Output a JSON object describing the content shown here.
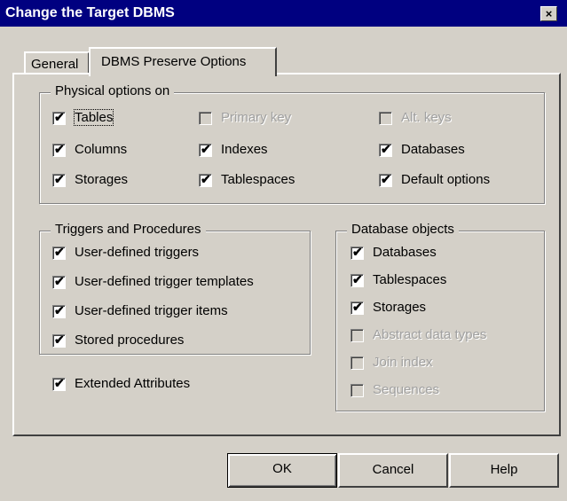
{
  "window": {
    "title": "Change the Target DBMS",
    "close_glyph": "×"
  },
  "tabs": [
    {
      "label": "General"
    },
    {
      "label": "DBMS Preserve Options"
    }
  ],
  "physical_options": {
    "title": "Physical options on",
    "items": [
      {
        "label": "Tables",
        "checked": true,
        "enabled": true
      },
      {
        "label": "Primary key",
        "checked": false,
        "enabled": false
      },
      {
        "label": "Alt. keys",
        "checked": false,
        "enabled": false
      },
      {
        "label": "Columns",
        "checked": true,
        "enabled": true
      },
      {
        "label": "Indexes",
        "checked": true,
        "enabled": true
      },
      {
        "label": "Databases",
        "checked": true,
        "enabled": true
      },
      {
        "label": "Storages",
        "checked": true,
        "enabled": true
      },
      {
        "label": "Tablespaces",
        "checked": true,
        "enabled": true
      },
      {
        "label": "Default options",
        "checked": true,
        "enabled": true
      }
    ]
  },
  "triggers": {
    "title": "Triggers and Procedures",
    "items": [
      {
        "label": "User-defined triggers",
        "checked": true,
        "enabled": true
      },
      {
        "label": "User-defined trigger templates",
        "checked": true,
        "enabled": true
      },
      {
        "label": "User-defined trigger items",
        "checked": true,
        "enabled": true
      },
      {
        "label": "Stored procedures",
        "checked": true,
        "enabled": true
      }
    ]
  },
  "extended": {
    "label": "Extended Attributes",
    "checked": true,
    "enabled": true
  },
  "db_objects": {
    "title": "Database objects",
    "items": [
      {
        "label": "Databases",
        "checked": true,
        "enabled": true
      },
      {
        "label": "Tablespaces",
        "checked": true,
        "enabled": true
      },
      {
        "label": "Storages",
        "checked": true,
        "enabled": true
      },
      {
        "label": "Abstract data types",
        "checked": false,
        "enabled": false
      },
      {
        "label": "Join index",
        "checked": false,
        "enabled": false
      },
      {
        "label": "Sequences",
        "checked": false,
        "enabled": false
      }
    ]
  },
  "buttons": {
    "ok": "OK",
    "cancel": "Cancel",
    "help": "Help"
  },
  "check_glyph": "✔"
}
